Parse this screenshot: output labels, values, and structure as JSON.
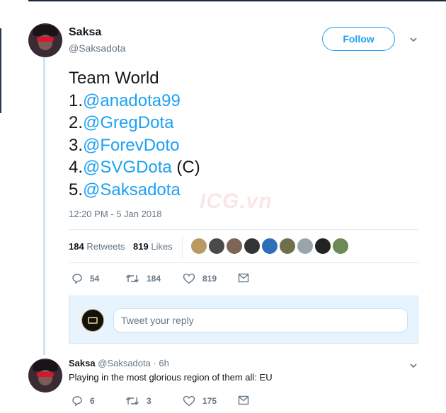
{
  "tweet": {
    "author_name": "Saksa",
    "author_handle": "@Saksadota",
    "follow_label": "Follow",
    "text_lines": [
      {
        "prefix": "Team World",
        "mention": "",
        "suffix": ""
      },
      {
        "prefix": "1.",
        "mention": "@anadota99",
        "suffix": ""
      },
      {
        "prefix": "2.",
        "mention": "@GregDota",
        "suffix": ""
      },
      {
        "prefix": "3.",
        "mention": "@ForevDoto",
        "suffix": ""
      },
      {
        "prefix": "4.",
        "mention": "@SVGDota",
        "suffix": " (C)"
      },
      {
        "prefix": "5.",
        "mention": "@Saksadota",
        "suffix": ""
      }
    ],
    "timestamp": "12:20 PM - 5 Jan 2018",
    "retweets_count": "184",
    "retweets_label": "Retweets",
    "likes_count": "819",
    "likes_label": "Likes",
    "liker_colors": [
      "#b89a62",
      "#4a4a4a",
      "#7d6655",
      "#333333",
      "#2d6fb8",
      "#6f6f4c",
      "#9aa4ad",
      "#222222",
      "#6b8a55"
    ],
    "actions": {
      "reply_count": "54",
      "retweet_count": "184",
      "like_count": "819"
    }
  },
  "watermark": "ICG.vn",
  "reply_box": {
    "placeholder": "Tweet your reply"
  },
  "reply": {
    "author_name": "Saksa",
    "author_handle": "@Saksadota",
    "time": "· 6h",
    "text": "Playing in the most glorious region of them all: EU",
    "actions": {
      "reply_count": "6",
      "retweet_count": "3",
      "like_count": "175"
    }
  },
  "icons": [
    "chevron-down-icon",
    "reply-icon",
    "retweet-icon",
    "heart-icon",
    "mail-icon"
  ]
}
